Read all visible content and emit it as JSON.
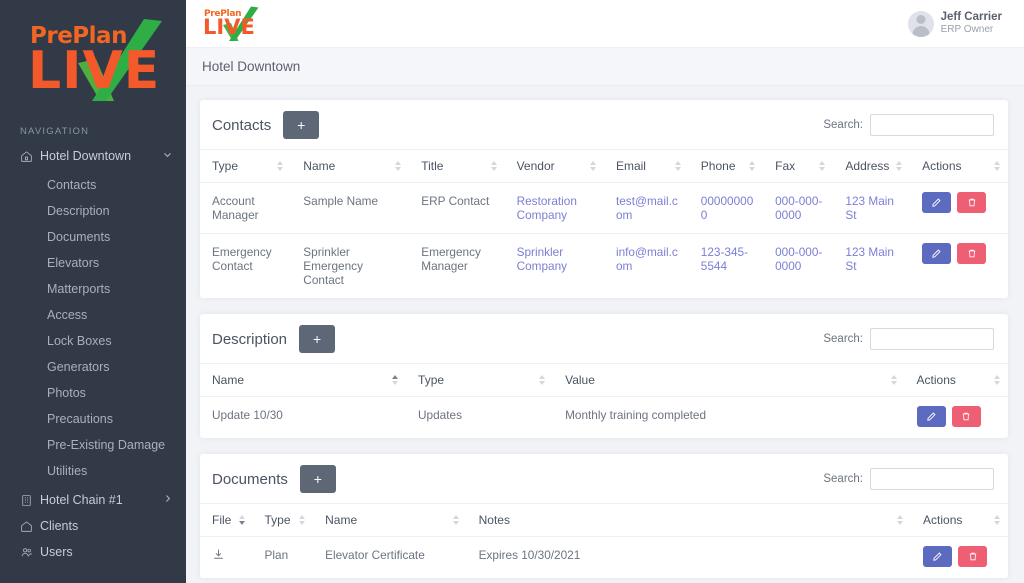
{
  "brand": {
    "pre": "PrePlan",
    "live": "LIVE"
  },
  "sidebar": {
    "nav_label": "NAVIGATION",
    "primary": {
      "label": "Hotel Downtown",
      "icon": "home-icon",
      "caret": "⌄"
    },
    "sub_items": [
      {
        "label": "Contacts"
      },
      {
        "label": "Description"
      },
      {
        "label": "Documents"
      },
      {
        "label": "Elevators"
      },
      {
        "label": "Matterports"
      },
      {
        "label": "Access"
      },
      {
        "label": "Lock Boxes"
      },
      {
        "label": "Generators"
      },
      {
        "label": "Photos"
      },
      {
        "label": "Precautions"
      },
      {
        "label": "Pre-Existing Damage"
      },
      {
        "label": "Utilities"
      }
    ],
    "bottom_items": [
      {
        "label": "Hotel Chain #1",
        "icon": "building-icon",
        "caret": "›"
      },
      {
        "label": "Clients",
        "icon": "home-icon",
        "caret": ""
      },
      {
        "label": "Users",
        "icon": "users-icon",
        "caret": ""
      }
    ]
  },
  "topbar": {
    "user_name": "Jeff Carrier",
    "user_role": "ERP Owner"
  },
  "breadcrumb": {
    "title": "Hotel Downtown"
  },
  "cards": {
    "contacts": {
      "title": "Contacts",
      "add_label": "+",
      "search_label": "Search:",
      "search_value": "",
      "search_placeholder": "",
      "columns": [
        {
          "label": "Type",
          "sort": "none"
        },
        {
          "label": "Name",
          "sort": "none"
        },
        {
          "label": "Title",
          "sort": "none"
        },
        {
          "label": "Vendor",
          "sort": "none"
        },
        {
          "label": "Email",
          "sort": "none"
        },
        {
          "label": "Phone",
          "sort": "none"
        },
        {
          "label": "Fax",
          "sort": "none"
        },
        {
          "label": "Address",
          "sort": "none"
        },
        {
          "label": "Actions",
          "sort": "none"
        }
      ],
      "rows": [
        {
          "type": "Account Manager",
          "name": "Sample Name",
          "title": "ERP Contact",
          "vendor": "Restoration Company",
          "email": "test@mail.com",
          "phone": "000000000",
          "fax": "000-000-0000",
          "address": "123 Main St"
        },
        {
          "type": "Emergency Contact",
          "name": "Sprinkler Emergency Contact",
          "title": "Emergency Manager",
          "vendor": "Sprinkler Company",
          "email": "info@mail.com",
          "phone": "123-345-5544",
          "fax": "000-000-0000",
          "address": "123 Main St"
        }
      ]
    },
    "description": {
      "title": "Description",
      "add_label": "+",
      "search_label": "Search:",
      "search_value": "",
      "search_placeholder": "",
      "columns": [
        {
          "label": "Name",
          "sort": "asc"
        },
        {
          "label": "Type",
          "sort": "none"
        },
        {
          "label": "Value",
          "sort": "none"
        },
        {
          "label": "Actions",
          "sort": "none"
        }
      ],
      "rows": [
        {
          "name": "Update 10/30",
          "type": "Updates",
          "value": "Monthly training completed"
        }
      ]
    },
    "documents": {
      "title": "Documents",
      "add_label": "+",
      "search_label": "Search:",
      "search_value": "",
      "search_placeholder": "",
      "columns": [
        {
          "label": "File",
          "sort": "desc"
        },
        {
          "label": "Type",
          "sort": "none"
        },
        {
          "label": "Name",
          "sort": "none"
        },
        {
          "label": "Notes",
          "sort": "none"
        },
        {
          "label": "Actions",
          "sort": "none"
        }
      ],
      "rows": [
        {
          "file_icon": "download-icon",
          "type": "Plan",
          "name": "Elevator Certificate",
          "notes": "Expires 10/30/2021"
        }
      ]
    }
  },
  "colors": {
    "sidebar_bg": "#313a46",
    "edit_button": "#5c6bc0",
    "delete_button": "#ef5f74",
    "add_button": "#5d6776",
    "link": "#7b7fd4",
    "brand_orange": "#f4592b",
    "brand_green": "#4caf3f"
  }
}
